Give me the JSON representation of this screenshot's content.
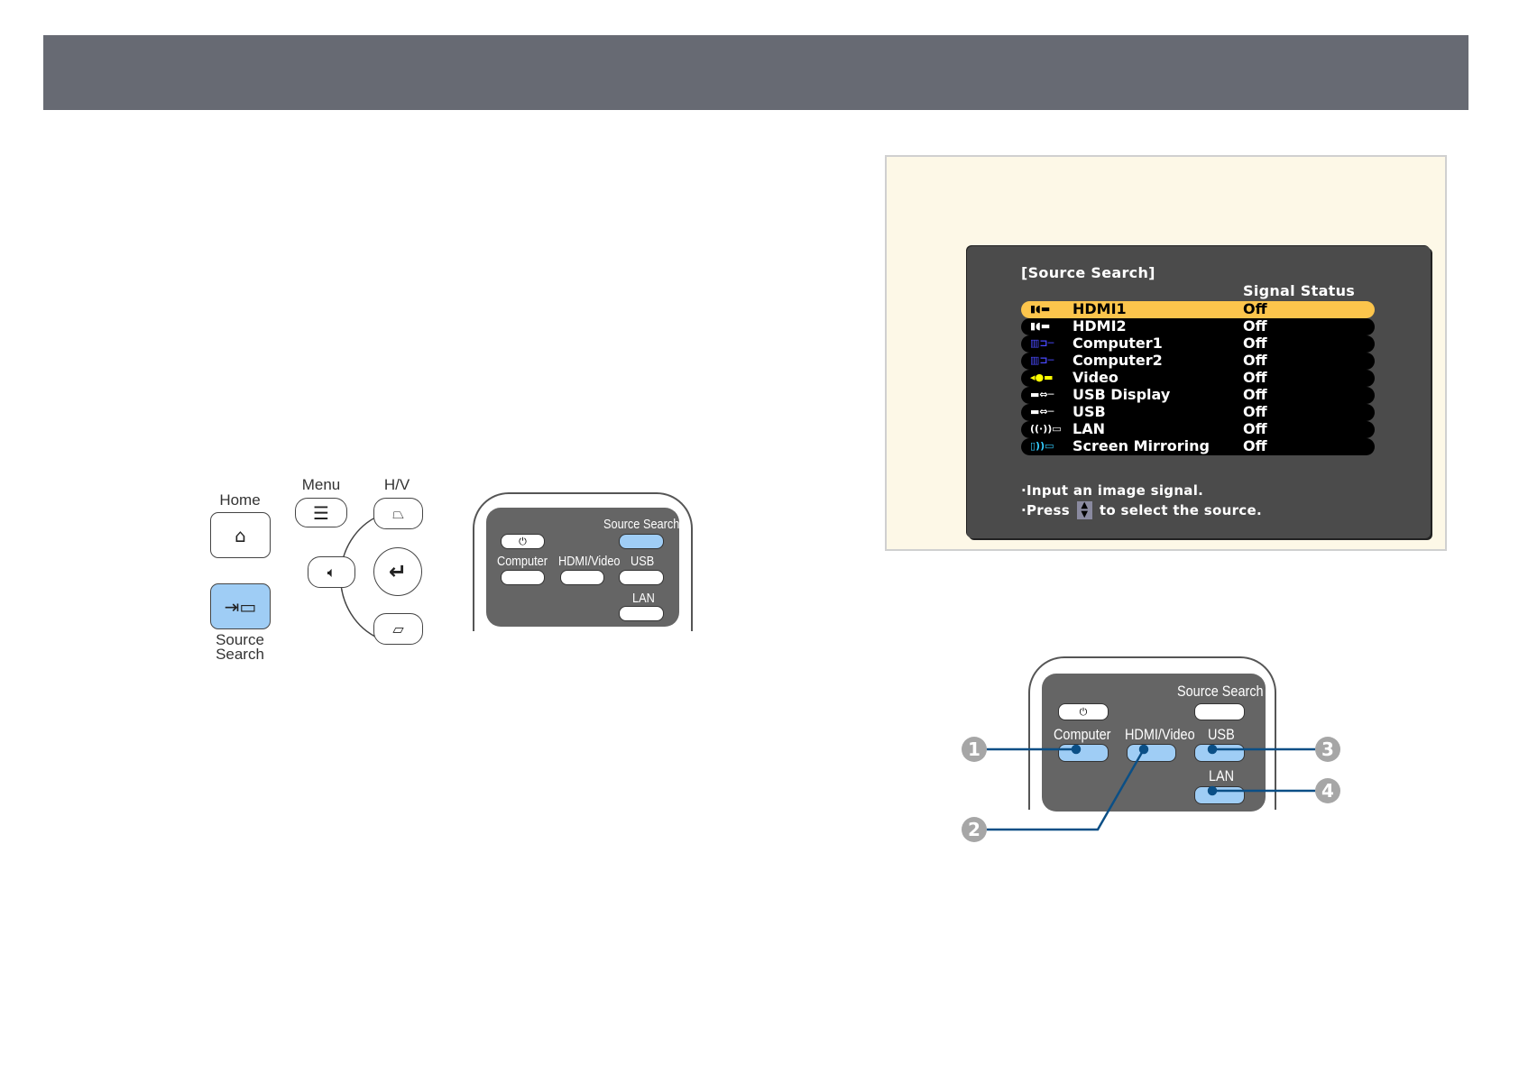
{
  "osd": {
    "title": "[Source Search]",
    "status_header": "Signal Status",
    "rows": [
      {
        "name": "HDMI1",
        "status": "Off",
        "icon": "hdmi-icon",
        "selected": true
      },
      {
        "name": "HDMI2",
        "status": "Off",
        "icon": "hdmi-icon"
      },
      {
        "name": "Computer1",
        "status": "Off",
        "icon": "vga-icon"
      },
      {
        "name": "Computer2",
        "status": "Off",
        "icon": "vga-icon"
      },
      {
        "name": "Video",
        "status": "Off",
        "icon": "rca-icon"
      },
      {
        "name": "USB Display",
        "status": "Off",
        "icon": "usb-icon"
      },
      {
        "name": "USB",
        "status": "Off",
        "icon": "usb-icon"
      },
      {
        "name": "LAN",
        "status": "Off",
        "icon": "lan-icon"
      },
      {
        "name": "Screen Mirroring",
        "status": "Off",
        "icon": "mirroring-icon"
      }
    ],
    "hint1": "·Input an image signal.",
    "hint2_pre": "·Press",
    "hint2_post": "to select the source.",
    "highlight_color": "#fcc54c"
  },
  "control_panel": {
    "home": "Home",
    "menu": "Menu",
    "hv": "H/V",
    "source_search_1": "Source",
    "source_search_2": "Search"
  },
  "remote": {
    "source_search": "Source Search",
    "computer": "Computer",
    "hdmi_video": "HDMI/Video",
    "usb": "USB",
    "lan": "LAN",
    "power": "⏻"
  },
  "callouts": [
    "1",
    "2",
    "3",
    "4"
  ],
  "button_highlight_color": "#9fcdf5"
}
